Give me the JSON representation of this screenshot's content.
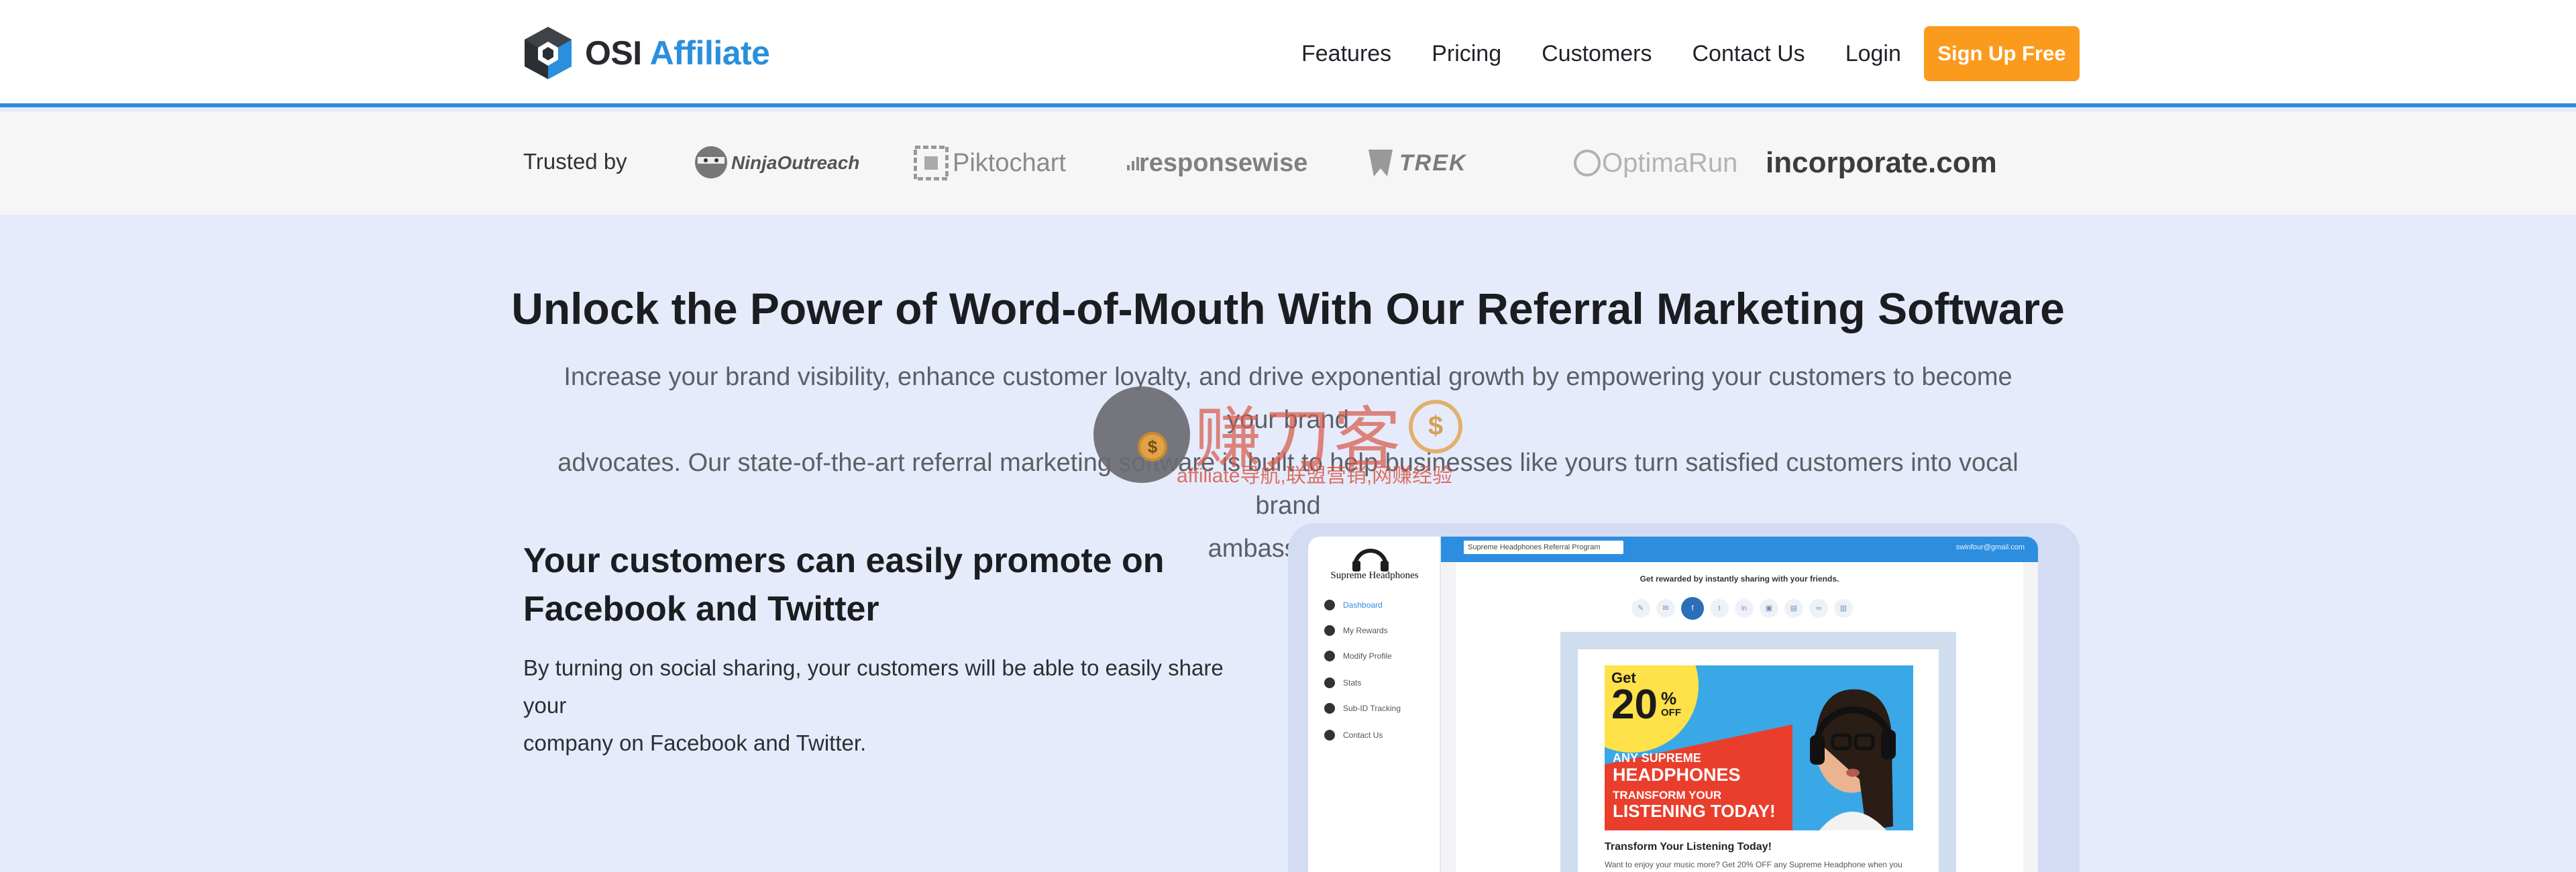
{
  "header": {
    "logo": {
      "name_primary": "OSI",
      "name_secondary": "Affiliate"
    },
    "nav": {
      "features": "Features",
      "pricing": "Pricing",
      "customers": "Customers",
      "contact": "Contact Us",
      "login": "Login",
      "signup": "Sign Up Free"
    }
  },
  "trusted": {
    "label": "Trusted by",
    "brands": [
      "NinjaOutreach",
      "Piktochart",
      "responsewise",
      "TREK",
      "OptimaRun",
      "incorporate.com"
    ]
  },
  "hero": {
    "title": "Unlock the Power of Word-of-Mouth With Our Referral Marketing Software",
    "description_line1": "Increase your brand visibility, enhance customer loyalty, and drive exponential growth by empowering your customers to become your brand",
    "description_line2": "advocates. Our state-of-the-art referral marketing software is built to help businesses like yours turn satisfied customers into vocal brand",
    "description_line3": "ambassadors."
  },
  "watermark": {
    "title": "赚刀客",
    "subtitle": "affiliate导航,联盟营销,网赚经验",
    "coin": "$"
  },
  "feature": {
    "title_line1": "Your customers can easily promote on",
    "title_line2": "Facebook and Twitter",
    "desc_line1": "By turning on social sharing, your customers will be able to easily share your",
    "desc_line2": "company on Facebook and Twitter."
  },
  "mock": {
    "brand": "Supreme Headphones",
    "program": "Supreme Headphones Referral Program",
    "user_email": "swinfour@gmail.com",
    "sidebar": [
      "Dashboard",
      "My Rewards",
      "Modify Profile",
      "Stats",
      "Sub-ID Tracking",
      "Contact Us"
    ],
    "share_caption": "Get rewarded by instantly sharing with your friends.",
    "share_icons": [
      "link",
      "email",
      "facebook",
      "twitter",
      "linkedin",
      "image",
      "doc",
      "link",
      "file"
    ],
    "ad": {
      "get": "Get",
      "percent": "20",
      "percent_sign": "%",
      "off": "OFF",
      "line1": "ANY SUPREME",
      "line2": "HEADPHONES",
      "line3": "TRANSFORM YOUR",
      "line4": "LISTENING TODAY!",
      "title": "Transform Your Listening Today!",
      "text": "Want to enjoy your music more? Get 20% OFF any Supreme Headphone when you"
    }
  },
  "colors": {
    "accent_blue": "#2d8ee0",
    "cta_orange": "#fb9b1e",
    "hero_bg": "#e6ebfb"
  }
}
